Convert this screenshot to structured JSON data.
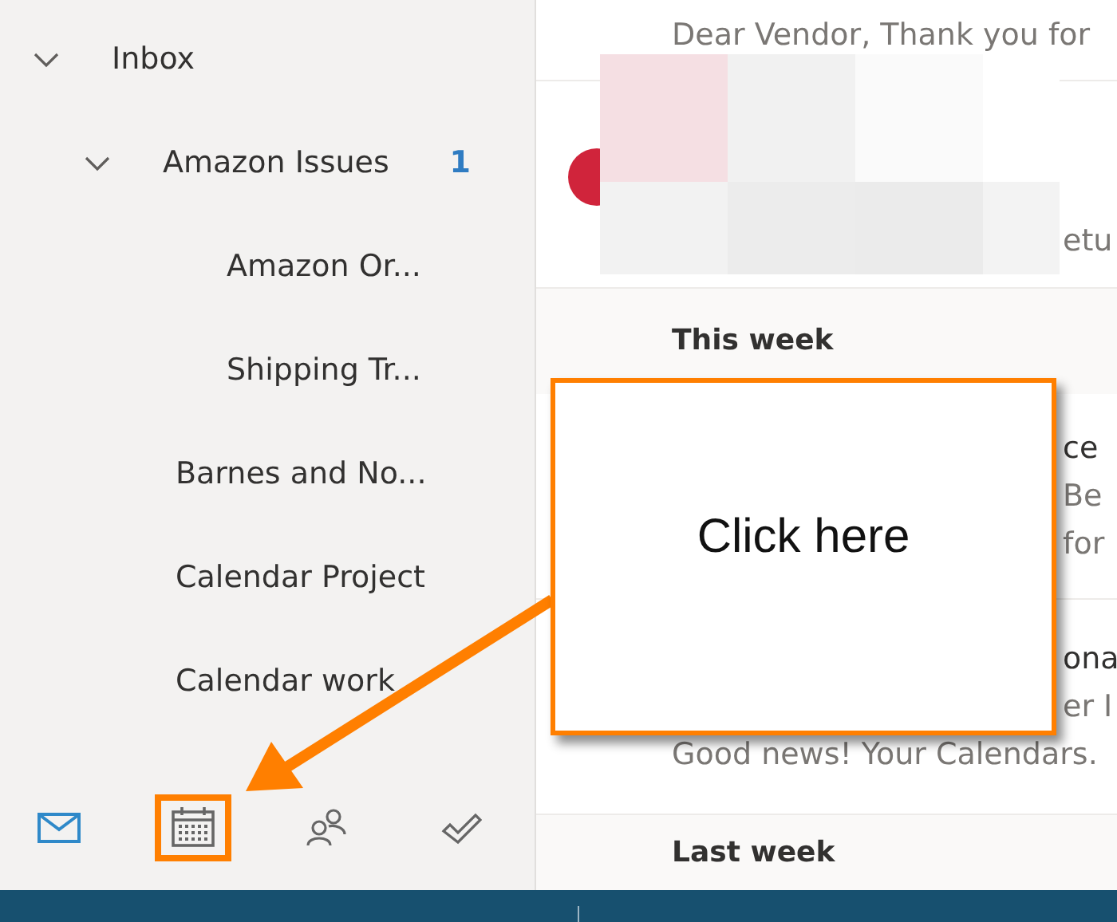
{
  "folders": [
    {
      "label": "Inbox",
      "expanded": true,
      "children": [
        {
          "label": "Amazon Issues",
          "expanded": true,
          "count": "1",
          "children": [
            {
              "label": "Amazon Or..."
            },
            {
              "label": "Shipping Tr..."
            }
          ]
        },
        {
          "label": "Barnes and No..."
        },
        {
          "label": "Calendar Project"
        },
        {
          "label": "Calendar work"
        }
      ]
    }
  ],
  "nav_items": [
    {
      "kind": "mail",
      "selected": true,
      "highlighted": false
    },
    {
      "kind": "calendar",
      "selected": false,
      "highlighted": true
    },
    {
      "kind": "people",
      "selected": false,
      "highlighted": false
    },
    {
      "kind": "tasks",
      "selected": false,
      "highlighted": false
    }
  ],
  "message_list": [
    {
      "kind": "message",
      "lines": [
        {
          "kind": "preview",
          "text": "Dear Vendor, Thank you for"
        }
      ]
    },
    {
      "kind": "message",
      "avatar": true,
      "redacted": true,
      "lines": [
        {
          "kind": "clipped",
          "text": "etu"
        }
      ]
    },
    {
      "kind": "header",
      "label": "This week"
    },
    {
      "kind": "message",
      "lines": [
        {
          "kind": "clipped",
          "text": "ce",
          "strong": true
        },
        {
          "kind": "clipped",
          "text": "Be"
        },
        {
          "kind": "clipped",
          "text": "for"
        }
      ]
    },
    {
      "kind": "message",
      "lines": [
        {
          "kind": "clipped",
          "text": "ona",
          "strong": true
        },
        {
          "kind": "clipped",
          "text": "er I"
        },
        {
          "kind": "preview",
          "text": "Good news! Your Calendars."
        }
      ]
    },
    {
      "kind": "header",
      "label": "Last week"
    }
  ],
  "callout": {
    "text": "Click here"
  }
}
